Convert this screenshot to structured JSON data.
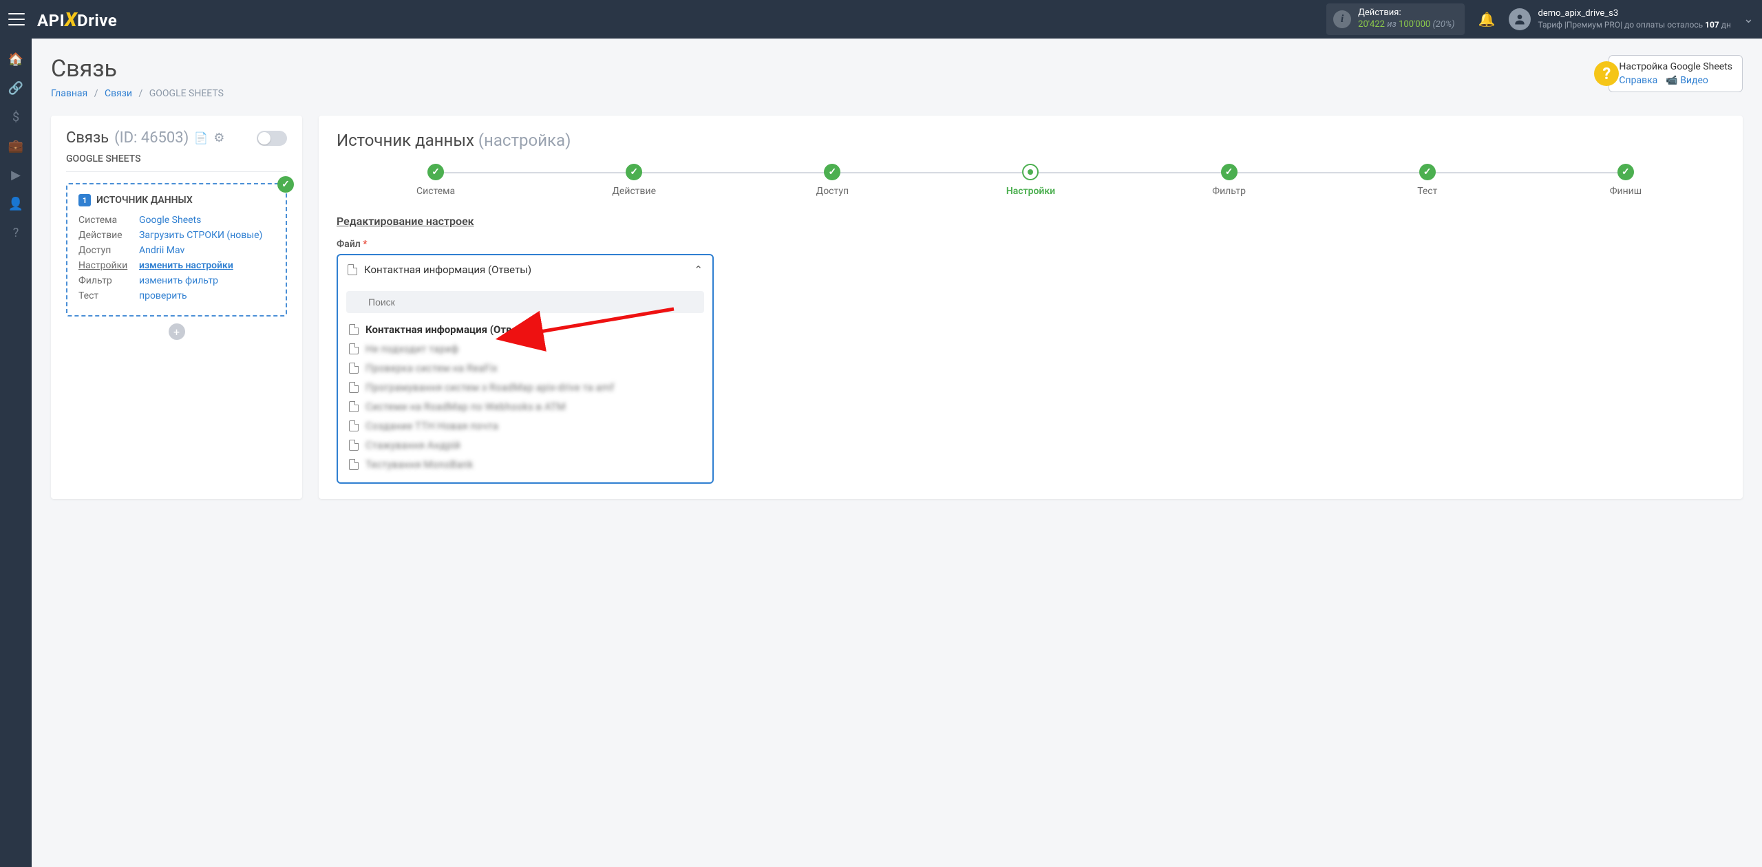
{
  "topbar": {
    "actions_label": "Действия:",
    "actions_used": "20'422",
    "actions_of": "из",
    "actions_total": "100'000",
    "actions_pct": "(20%)"
  },
  "user": {
    "name": "demo_apix_drive_s3",
    "tariff_prefix": "Тариф |Премиум PRO| до оплаты осталось ",
    "days": "107",
    "days_suffix": " дн"
  },
  "page": {
    "title": "Связь",
    "breadcrumb_home": "Главная",
    "breadcrumb_links": "Связи",
    "breadcrumb_current": "GOOGLE SHEETS"
  },
  "help": {
    "title": "Настройка Google Sheets",
    "link_help": "Справка",
    "link_video": "Видео"
  },
  "conn": {
    "label": "Связь",
    "id": "(ID: 46503)",
    "subtitle": "GOOGLE SHEETS"
  },
  "source": {
    "title": "ИСТОЧНИК ДАННЫХ",
    "rows": {
      "system_l": "Система",
      "system_v": "Google Sheets",
      "action_l": "Действие",
      "action_v": "Загрузить СТРОКИ (новые)",
      "access_l": "Доступ",
      "access_v": "Andrii Mav",
      "settings_l": "Настройки",
      "settings_v": "изменить настройки",
      "filter_l": "Фильтр",
      "filter_v": "изменить фильтр",
      "test_l": "Тест",
      "test_v": "проверить"
    }
  },
  "right": {
    "title": "Источник данных",
    "subtitle": "(настройка)",
    "edit_title": "Редактирование настроек",
    "field_label": "Файл"
  },
  "steps": {
    "s1": "Система",
    "s2": "Действие",
    "s3": "Доступ",
    "s4": "Настройки",
    "s5": "Фильтр",
    "s6": "Тест",
    "s7": "Финиш"
  },
  "dropdown": {
    "selected": "Контактная информация (Ответы)",
    "search_placeholder": "Поиск",
    "opt1": "Контактная информация (Ответы)",
    "opt2": "Не подходит тариф",
    "opt3": "Проверка систем на ReaFix",
    "opt4": "Програмування систем з RoadMap apix-drive та amf",
    "opt5": "Системи на RoadMap по Webhooks в АТМ",
    "opt6": "Создание ТТН Новая почта",
    "opt7": "Стажування Андрій",
    "opt8": "Тестування MonoBank"
  }
}
